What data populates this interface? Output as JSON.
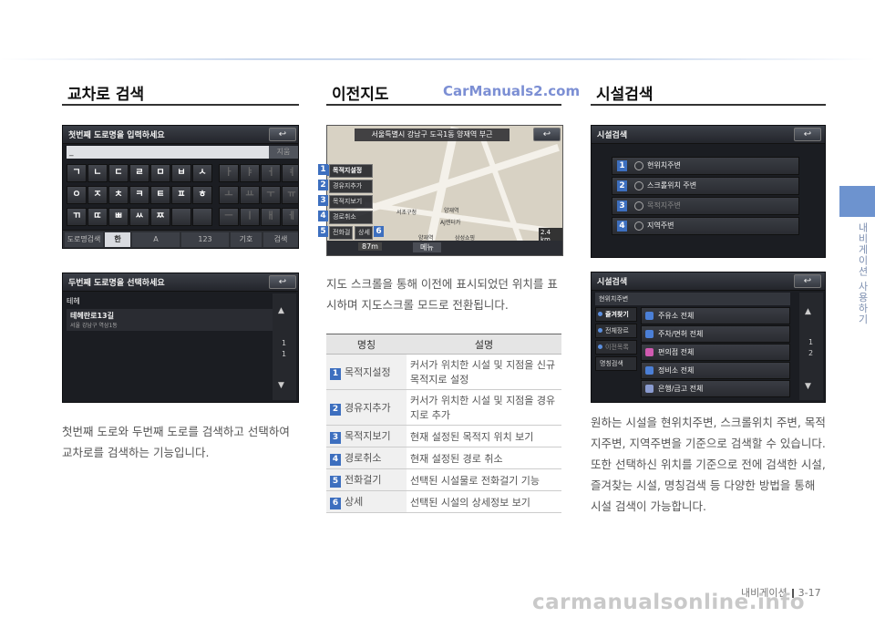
{
  "side_tab": "내비게이션 사용하기",
  "sections": {
    "intersection": {
      "title": "교차로 검색",
      "screen1": {
        "title": "첫번째 도로명을 입력하세요",
        "back": "↩",
        "input_value": "_",
        "input_btn": "지움",
        "keys_row1": [
          "ㄱ",
          "ㄴ",
          "ㄷ",
          "ㄹ",
          "ㅁ",
          "ㅂ",
          "ㅅ",
          "ㅏ",
          "ㅑ",
          "ㅓ",
          "ㅕ"
        ],
        "keys_row2": [
          "ㅇ",
          "ㅈ",
          "ㅊ",
          "ㅋ",
          "ㅌ",
          "ㅍ",
          "ㅎ",
          "ㅗ",
          "ㅛ",
          "ㅜ",
          "ㅠ"
        ],
        "keys_row3": [
          "ㄲ",
          "ㄸ",
          "ㅃ",
          "ㅆ",
          "ㅉ",
          "",
          "",
          "ㅡ",
          "ㅣ",
          "ㅐ",
          "ㅔ"
        ],
        "modes": [
          "도로명검색",
          "한",
          "A",
          "123",
          "기호",
          "검색"
        ]
      },
      "screen2": {
        "title": "두번째 도로명을 선택하세요",
        "back": "↩",
        "row1": "테헤",
        "row2_main": "테헤란로13길",
        "row2_sub": "서울 강남구 역삼1동",
        "up": "▲",
        "down": "▼",
        "page_a": "1",
        "page_b": "1"
      },
      "body": "첫번째 도로와 두번째 도로를 검색하고 선택하여 교차로를 검색하는 기능입니다."
    },
    "previous_map": {
      "title": "이전지도",
      "watermark": "CarManuals2.com",
      "map": {
        "header": "서울특별시 강남구 도곡1동 양재역 부근",
        "back": "↩",
        "buttons": [
          "목적지설정",
          "경유지추가",
          "목적지보기",
          "경로취소",
          "전화걸기"
        ],
        "detail_btn": "상세",
        "labels": [
          "서초구청",
          "양재역",
          "AJ렌터카",
          "양재역",
          "삼성쇼핑"
        ],
        "distance": "87m",
        "menu": "메뉴",
        "scale": "2.4 km"
      },
      "numbers": [
        "1",
        "2",
        "3",
        "4",
        "5",
        "6"
      ],
      "body": "지도 스크롤을 통해 이전에 표시되었던 위치를 표시하며 지도스크롤 모드로 전환됩니다.",
      "table": {
        "headers": [
          "명칭",
          "설명"
        ],
        "rows": [
          {
            "num": "1",
            "name": "목적지설정",
            "desc": "커서가 위치한 시설 및 지점을 신규 목적지로 설정"
          },
          {
            "num": "2",
            "name": "경유지추가",
            "desc": "커서가 위치한 시설 및 지점을 경유지로 추가"
          },
          {
            "num": "3",
            "name": "목적지보기",
            "desc": "현재 설정된 목적지 위치 보기"
          },
          {
            "num": "4",
            "name": "경로취소",
            "desc": "현재 설정된 경로 취소"
          },
          {
            "num": "5",
            "name": "전화걸기",
            "desc": "선택된 시설물로 전화걸기 기능"
          },
          {
            "num": "6",
            "name": "상세",
            "desc": "선택된 시설의 상세정보 보기"
          }
        ]
      }
    },
    "facility": {
      "title": "시설검색",
      "screen1": {
        "title": "시설검색",
        "back": "↩",
        "rows": [
          "현위치주변",
          "스크롤위치 주변",
          "목적지주변",
          "지역주변"
        ],
        "numbers": [
          "1",
          "2",
          "3",
          "4"
        ]
      },
      "screen2": {
        "title": "시설검색",
        "back": "↩",
        "tab": "현위치주변",
        "side": [
          "즐겨찾기",
          "전체장르",
          "이전목록",
          "명칭검색"
        ],
        "rows": [
          "주유소 전체",
          "주차/면허 전체",
          "편의점 전체",
          "정비소 전체",
          "은행/금고 전체"
        ],
        "up": "▲",
        "down": "▼",
        "page_a": "1",
        "page_b": "2"
      },
      "body": "원하는 시설을 현위치주변, 스크롤위치 주변, 목적지주변, 지역주변을 기준으로 검색할 수 있습니다. 또한 선택하신 위치를 기준으로 전에 검색한 시설, 즐겨찾는 시설, 명칭검색 등 다양한 방법을 통해 시설 검색이 가능합니다."
    }
  },
  "footer": {
    "label": "내비게이션",
    "page": "3-17"
  },
  "watermark_bottom": "carmanualsonline.info",
  "colors": {
    "accent": "#3d6fbf",
    "side_tab": "#6d93cf",
    "screen_bg": "#1b1d22"
  }
}
